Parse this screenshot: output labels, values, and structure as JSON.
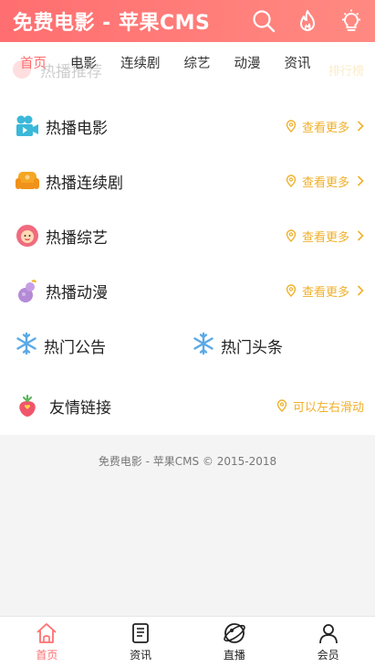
{
  "header": {
    "title": "免费电影 - 苹果CMS",
    "icons": [
      "search-icon",
      "flame-icon",
      "lightbulb-icon"
    ]
  },
  "nav": {
    "tabs": [
      {
        "label": "首页",
        "active": true
      },
      {
        "label": "电影",
        "active": false
      },
      {
        "label": "连续剧",
        "active": false
      },
      {
        "label": "综艺",
        "active": false
      },
      {
        "label": "动漫",
        "active": false
      },
      {
        "label": "资讯",
        "active": false
      }
    ],
    "overlay": {
      "label": "热播推荐",
      "more": "排行榜"
    }
  },
  "sections": [
    {
      "label": "热播电影",
      "icon": "movie-camera-icon",
      "more": "查看更多"
    },
    {
      "label": "热播连续剧",
      "icon": "sofa-icon",
      "more": "查看更多"
    },
    {
      "label": "热播综艺",
      "icon": "flower-icon",
      "more": "查看更多"
    },
    {
      "label": "热播动漫",
      "icon": "gourd-icon",
      "more": "查看更多"
    }
  ],
  "notices": {
    "left": "热门公告",
    "right": "热门头条",
    "icon": "snowflake-icon"
  },
  "links": {
    "label": "友情链接",
    "hint": "可以左右滑动",
    "icon": "strawberry-icon"
  },
  "footer": {
    "copyright": "免费电影 - 苹果CMS © 2015-2018"
  },
  "bottom_nav": [
    {
      "label": "首页",
      "icon": "home-icon",
      "active": true
    },
    {
      "label": "资讯",
      "icon": "document-icon",
      "active": false
    },
    {
      "label": "直播",
      "icon": "planet-icon",
      "active": false
    },
    {
      "label": "会员",
      "icon": "user-icon",
      "active": false
    }
  ],
  "colors": {
    "brand": "#ff6e70",
    "accent": "#f0b02a",
    "background": "#f4f4f4"
  }
}
